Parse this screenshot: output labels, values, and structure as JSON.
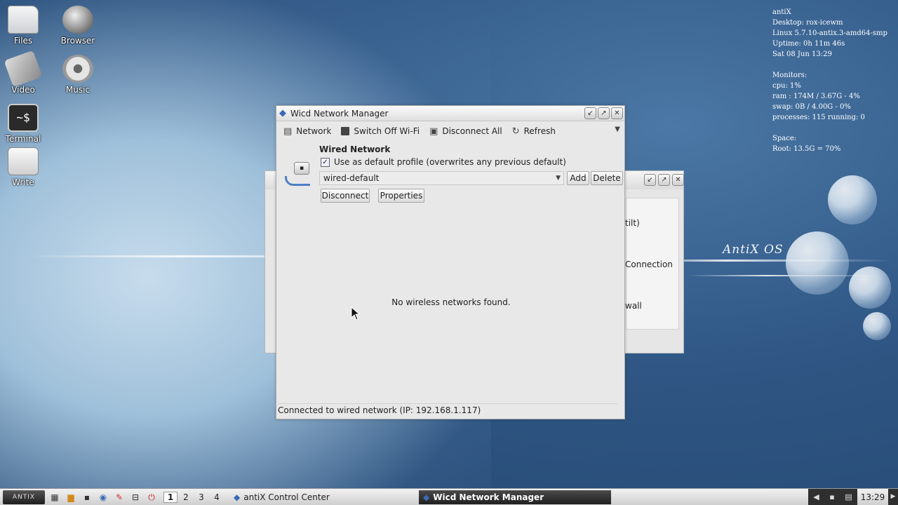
{
  "desktop": {
    "brand_text": "AntiX OS",
    "icons": [
      {
        "label": "Files",
        "icon": "folder-icon"
      },
      {
        "label": "Browser",
        "icon": "globe-icon"
      },
      {
        "label": "Video",
        "icon": "video-icon"
      },
      {
        "label": "Music",
        "icon": "music-icon"
      },
      {
        "label": "Terminal",
        "icon": "terminal-icon"
      },
      {
        "label": "Write",
        "icon": "write-icon"
      }
    ],
    "terminal_glyph": "~$"
  },
  "conky": {
    "lines": [
      "antiX",
      "Desktop: rox-icewm",
      "Linux 5.7.10-antix.3-amd64-smp",
      "Uptime: 0h 11m 46s",
      "Sat 08 Jun 13:29"
    ],
    "monitors_header": "Monitors:",
    "monitors": [
      "cpu: 1%",
      "ram : 174M / 3.67G - 4%",
      "swap: 0B  / 4.00G - 0%",
      "processes: 115   running: 0"
    ],
    "space_header": "Space:",
    "space": [
      "Root: 13.5G = 70%"
    ]
  },
  "background_window": {
    "fragments": [
      "tilt)",
      "Connection",
      "wall"
    ]
  },
  "wicd": {
    "title": "Wicd Network Manager",
    "toolbar": {
      "network": "Network",
      "switch_off_wifi": "Switch Off Wi-Fi",
      "disconnect_all": "Disconnect All",
      "refresh": "Refresh"
    },
    "wired": {
      "title": "Wired Network",
      "default_profile_checkbox": "Use as default profile (overwrites any previous default)",
      "default_profile_checked": true,
      "profile_selected": "wired-default",
      "add": "Add",
      "delete": "Delete",
      "disconnect": "Disconnect",
      "properties": "Properties"
    },
    "wireless_message": "No wireless networks found.",
    "status": "Connected to wired network (IP: 192.168.1.117)"
  },
  "taskbar": {
    "start_label": "ANTIX",
    "workspaces": [
      "1",
      "2",
      "3",
      "4"
    ],
    "active_workspace": "1",
    "tasks": [
      {
        "label": "antiX Control Center",
        "active": false
      },
      {
        "label": "Wicd Network Manager",
        "active": true
      }
    ],
    "clock": "13:29"
  },
  "colors": {
    "accent_blue": "#3b6bb5",
    "desktop_dark": "#2f5684"
  }
}
